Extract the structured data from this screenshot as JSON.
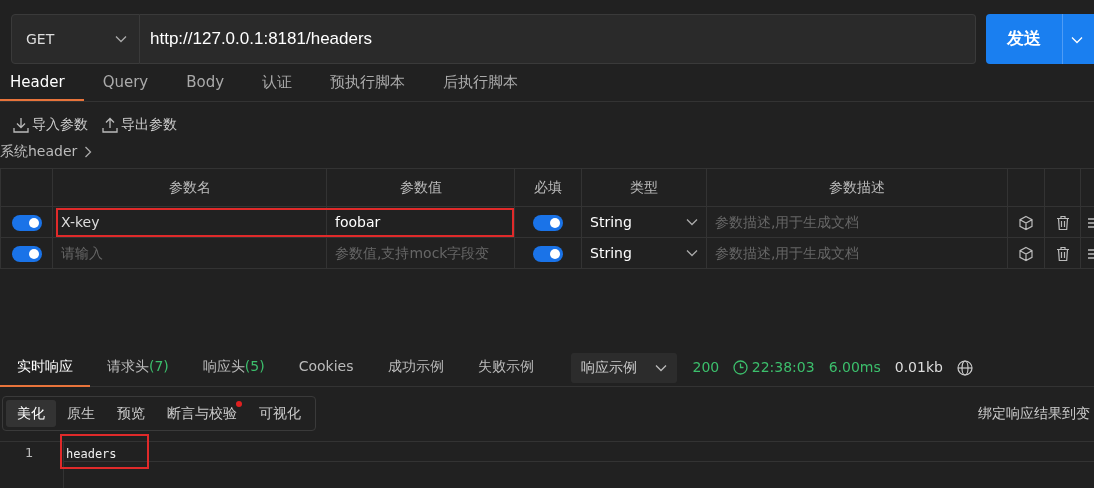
{
  "request": {
    "method": "GET",
    "url": "http://127.0.0.1:8181/headers",
    "send_label": "发送"
  },
  "tabs": [
    {
      "label": "Header",
      "selected": true
    },
    {
      "label": "Query",
      "selected": false
    },
    {
      "label": "Body",
      "selected": false
    },
    {
      "label": "认证",
      "selected": false
    },
    {
      "label": "预执行脚本",
      "selected": false
    },
    {
      "label": "后执行脚本",
      "selected": false
    }
  ],
  "actions": [
    {
      "kind": "import",
      "label": "导入参数"
    },
    {
      "kind": "export",
      "label": "导出参数"
    }
  ],
  "system_header": "系统header",
  "table": {
    "columns": [
      "参数名",
      "参数值",
      "必填",
      "类型",
      "参数描述"
    ],
    "rows": [
      {
        "enabled": true,
        "name": "X-key",
        "value": "foobar",
        "required": true,
        "type": "String",
        "description_placeholder": "参数描述,用于生成文档",
        "highlighted": true
      },
      {
        "enabled": true,
        "name_placeholder": "请输入",
        "value_placeholder": "参数值,支持mock字段变",
        "required": true,
        "type": "String",
        "description_placeholder": "参数描述,用于生成文档",
        "highlighted": false
      }
    ]
  },
  "response": {
    "tabs": [
      {
        "label": "实时响应",
        "selected": true
      },
      {
        "label": "请求头",
        "count": "(7)",
        "selected": false
      },
      {
        "label": "响应头",
        "count": "(5)",
        "selected": false
      },
      {
        "label": "Cookies",
        "selected": false
      },
      {
        "label": "成功示例",
        "selected": false
      },
      {
        "label": "失败示例",
        "selected": false
      }
    ],
    "example_select": "响应示例",
    "status": "200",
    "time": "22:38:03",
    "duration": "6.00ms",
    "size": "0.01kb",
    "views": [
      {
        "label": "美化",
        "selected": true,
        "dot": false
      },
      {
        "label": "原生",
        "selected": false,
        "dot": false
      },
      {
        "label": "预览",
        "selected": false,
        "dot": false
      },
      {
        "label": "断言与校验",
        "selected": false,
        "dot": true
      },
      {
        "label": "可视化",
        "selected": false,
        "dot": false
      }
    ],
    "bind_label": "绑定响应结果到变",
    "code_lines": [
      {
        "number": "1",
        "text": "headers",
        "highlighted": true
      }
    ]
  }
}
